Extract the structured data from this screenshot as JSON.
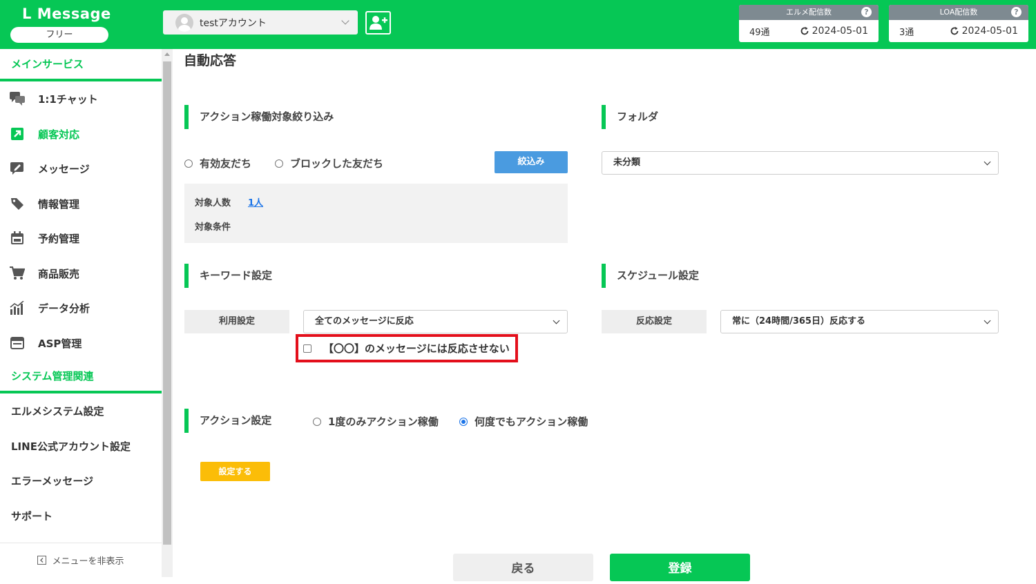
{
  "header": {
    "brand": "L Message",
    "plan": "フリー",
    "account": "testアカウント",
    "quota_lmessage": {
      "label": "エルメ配信数",
      "help": "?",
      "count": "49通",
      "date": "2024-05-01"
    },
    "quota_loa": {
      "label": "LOA配信数",
      "help": "?",
      "count": "3通",
      "date": "2024-05-01"
    }
  },
  "sidebar": {
    "section_main": "メインサービス",
    "items": [
      {
        "label": "1:1チャット",
        "icon": "chat-bubbles-icon"
      },
      {
        "label": "顧客対応",
        "icon": "arrow-up-right-icon"
      },
      {
        "label": "メッセージ",
        "icon": "message-edit-icon"
      },
      {
        "label": "情報管理",
        "icon": "tag-icon"
      },
      {
        "label": "予約管理",
        "icon": "calendar-icon"
      },
      {
        "label": "商品販売",
        "icon": "cart-icon"
      },
      {
        "label": "データ分析",
        "icon": "bar-chart-icon"
      },
      {
        "label": "ASP管理",
        "icon": "browser-window-icon"
      }
    ],
    "section_system": "システム管理関連",
    "system_items": [
      "エルメシステム設定",
      "LINE公式アカウント設定",
      "エラーメッセージ",
      "サポート"
    ],
    "hide_menu": "メニューを非表示"
  },
  "main": {
    "title": "自動応答",
    "filter": {
      "heading": "アクション稼働対象絞り込み",
      "radio_active": "有効友だち",
      "radio_blocked": "ブロックした友だち",
      "button": "絞込み",
      "count_label": "対象人数",
      "count_value": "1人",
      "condition_label": "対象条件"
    },
    "folder": {
      "heading": "フォルダ",
      "selected": "未分類"
    },
    "keyword": {
      "heading": "キーワード設定",
      "usage_label": "利用設定",
      "usage_selected": "全てのメッセージに反応",
      "checkbox_label": "【〇〇】のメッセージには反応させない"
    },
    "schedule": {
      "heading": "スケジュール設定",
      "response_label": "反応設定",
      "response_selected": "常に（24時間/365日）反応する"
    },
    "action": {
      "heading": "アクション設定",
      "radio_once": "1度のみアクション稼働",
      "radio_always": "何度でもアクション稼働",
      "set_button": "設定する"
    },
    "footer": {
      "back": "戻る",
      "register": "登録"
    }
  }
}
